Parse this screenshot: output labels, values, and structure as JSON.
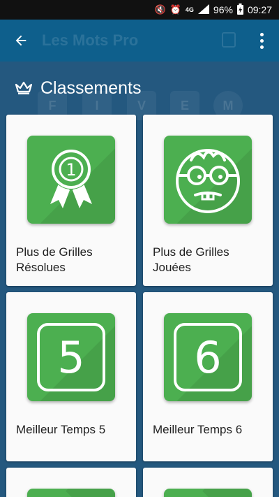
{
  "status_bar": {
    "battery": "96%",
    "time": "09:27",
    "icons": [
      "mute-icon",
      "alarm-icon",
      "4g-icon",
      "signal-icon",
      "battery-icon"
    ]
  },
  "app_bar": {
    "title": "Les Mots Pro",
    "back_icon": "arrow-back-icon",
    "menu_icon": "more-vert-icon"
  },
  "section": {
    "icon": "crown-icon",
    "title": "Classements"
  },
  "cards": [
    {
      "label": "Plus de Grilles Résolues",
      "icon": "ribbon-1-icon"
    },
    {
      "label": "Plus de Grilles Jouées",
      "icon": "nerd-face-icon"
    },
    {
      "label": "Meilleur Temps 5",
      "icon": "number-5-icon",
      "number": "5"
    },
    {
      "label": "Meilleur Temps 6",
      "icon": "number-6-icon",
      "number": "6"
    }
  ],
  "background_letters": [
    "F",
    "I",
    "V",
    "E",
    "M"
  ],
  "colors": {
    "background": "#24587f",
    "app_bar": "#0e5f8c",
    "tile_green": "#4caf50",
    "card": "#fafafa"
  }
}
